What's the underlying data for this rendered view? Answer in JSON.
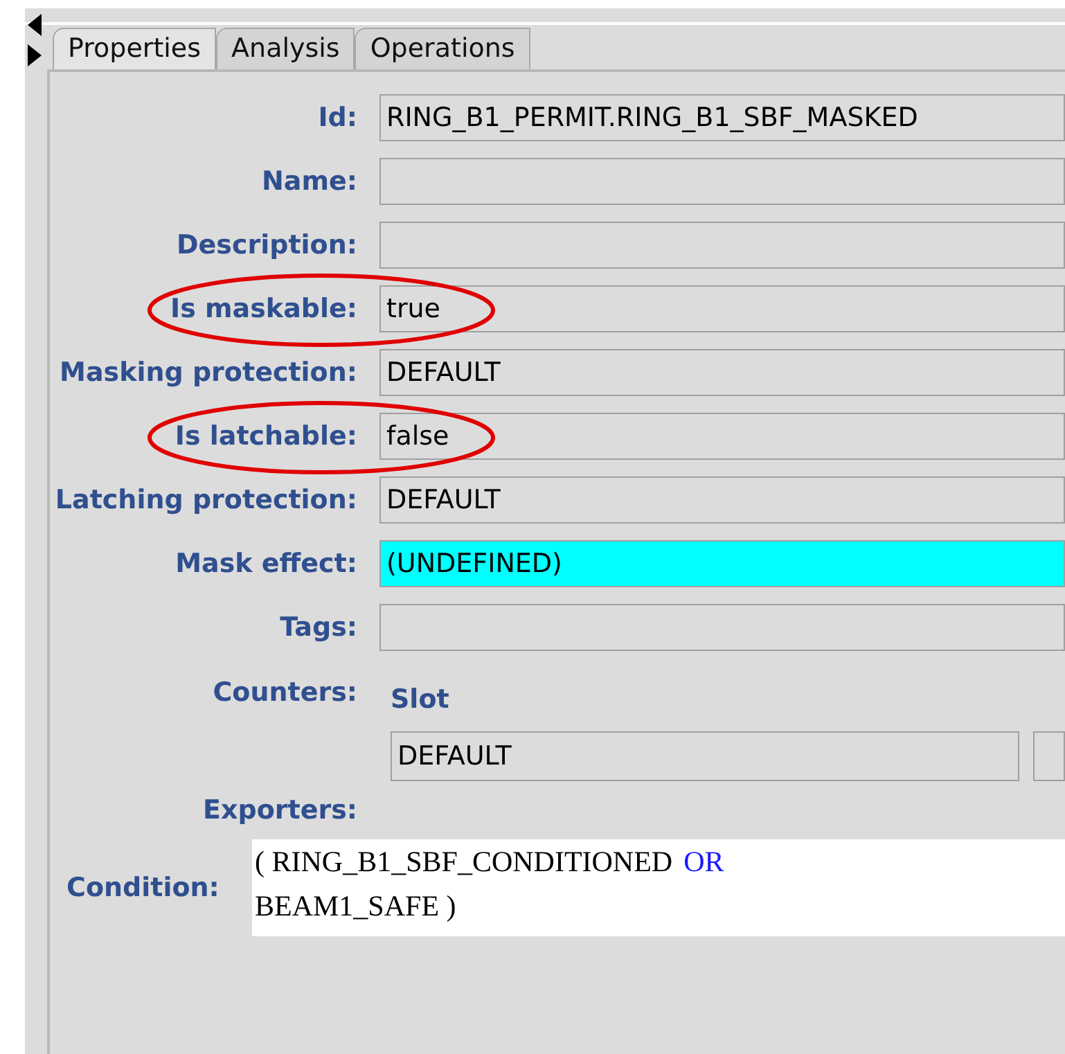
{
  "tabs": [
    {
      "label": "Properties",
      "selected": true
    },
    {
      "label": "Analysis",
      "selected": false
    },
    {
      "label": "Operations",
      "selected": false
    }
  ],
  "fields": [
    {
      "label": "Id:",
      "value": "RING_B1_PERMIT.RING_B1_SBF_MASKED",
      "kind": "text",
      "circled": false
    },
    {
      "label": "Name:",
      "kind": "text",
      "circled": false
    },
    {
      "label": "Description:",
      "kind": "text",
      "circled": false
    },
    {
      "label": "Is maskable:",
      "value": "true",
      "kind": "text",
      "circled": true
    },
    {
      "label": "Masking protection:",
      "value": "DEFAULT",
      "kind": "text",
      "circled": false
    },
    {
      "label": "Is latchable:",
      "value": "false",
      "kind": "text",
      "circled": true
    },
    {
      "label": "Latching protection:",
      "value": "DEFAULT",
      "kind": "text",
      "circled": false
    },
    {
      "label": "Mask effect:",
      "value": "(UNDEFINED)",
      "kind": "highlighted",
      "circled": false
    },
    {
      "label": "Tags:",
      "kind": "text",
      "circled": false
    }
  ],
  "counters": {
    "label": "Counters:",
    "columns": [
      {
        "header": "Slot",
        "value": "DEFAULT"
      },
      {}
    ]
  },
  "exporters": {
    "label": "Exporters:"
  },
  "condition": {
    "label": "Condition:",
    "parts": [
      {
        "text": "( RING_B1_SBF_CONDITIONED",
        "kind": "operand"
      },
      {
        "text": "OR",
        "kind": "operator"
      },
      {
        "text": "BEAM1_SAFE )",
        "kind": "operand"
      }
    ]
  }
}
